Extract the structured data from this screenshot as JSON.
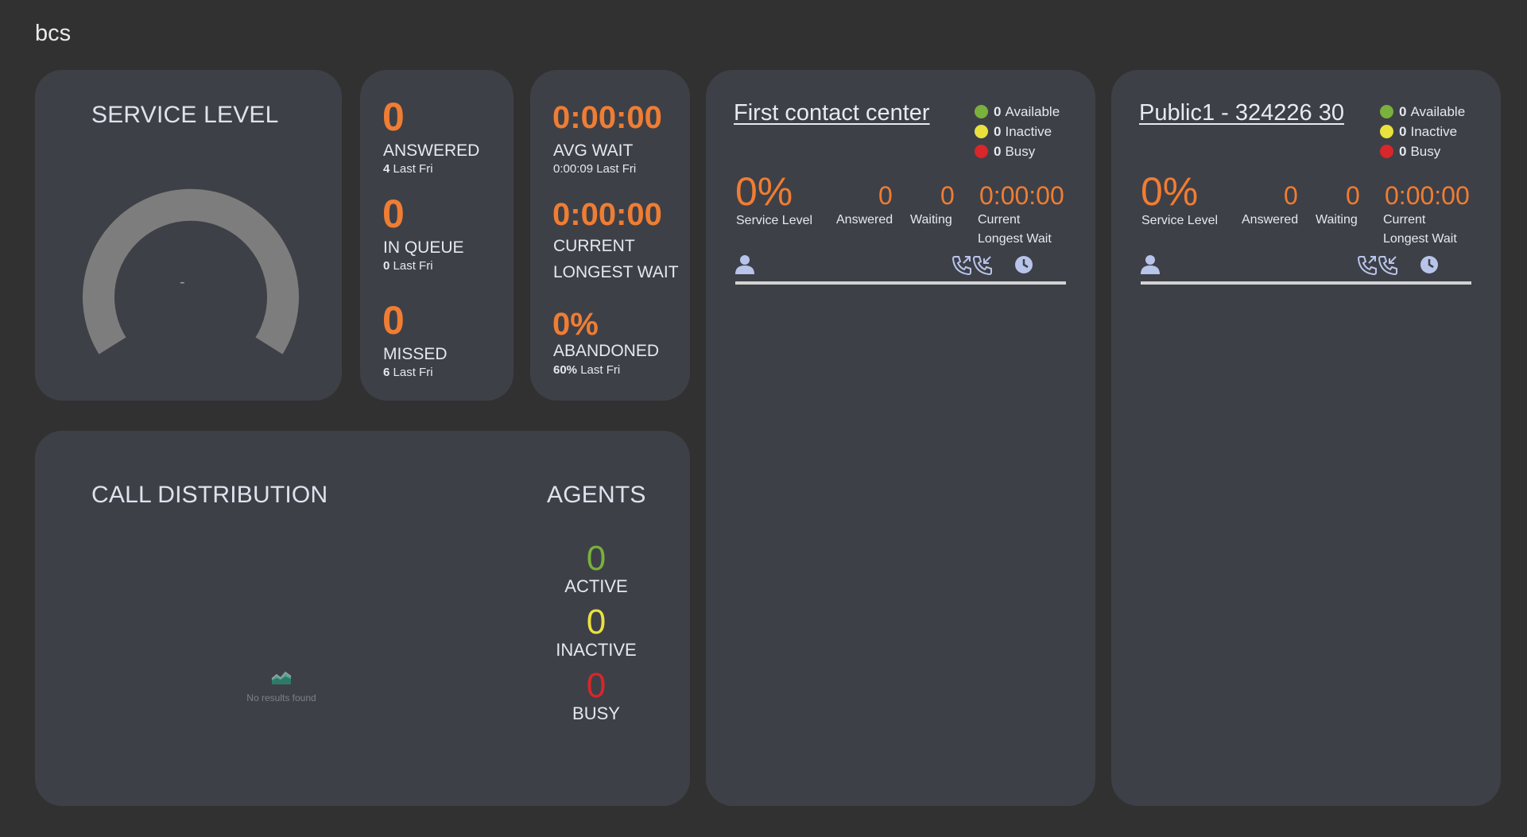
{
  "page": {
    "title": "bcs"
  },
  "service_level": {
    "title": "SERVICE LEVEL",
    "value": "-"
  },
  "stats_left": {
    "answered": {
      "value": "0",
      "label": "ANSWERED",
      "last_value": "4",
      "last_suffix": "Last Fri"
    },
    "in_queue": {
      "value": "0",
      "label": "IN QUEUE",
      "last_value": "0",
      "last_suffix": "Last Fri"
    },
    "missed": {
      "value": "0",
      "label": "MISSED",
      "last_value": "6",
      "last_suffix": "Last Fri"
    }
  },
  "stats_right": {
    "avg_wait": {
      "value": "0:00:00",
      "label": "AVG WAIT",
      "last_text": "0:00:09 Last Fri"
    },
    "longest_wait": {
      "value": "0:00:00",
      "label_line1": "CURRENT",
      "label_line2": "LONGEST WAIT"
    },
    "abandoned": {
      "value": "0%",
      "label": "ABANDONED",
      "last_value": "60%",
      "last_suffix": "Last Fri"
    }
  },
  "call_distribution": {
    "title": "CALL DISTRIBUTION",
    "empty_text": "No results found",
    "empty_icon": "area-chart-icon"
  },
  "agents": {
    "title": "AGENTS",
    "active": {
      "value": "0",
      "label": "ACTIVE",
      "color": "#7ab03c"
    },
    "inactive": {
      "value": "0",
      "label": "INACTIVE",
      "color": "#e9e23e"
    },
    "busy": {
      "value": "0",
      "label": "BUSY",
      "color": "#d9262a"
    }
  },
  "queues": [
    {
      "name": "First contact center",
      "legend": [
        {
          "count": "0",
          "label": "Available",
          "color": "#7ab03c"
        },
        {
          "count": "0",
          "label": "Inactive",
          "color": "#e9e23e"
        },
        {
          "count": "0",
          "label": "Busy",
          "color": "#d9262a"
        }
      ],
      "service_level": "0%",
      "service_level_label": "Service Level",
      "answered": "0",
      "answered_label": "Answered",
      "waiting": "0",
      "waiting_label": "Waiting",
      "longest_wait": "0:00:00",
      "longest_wait_label1": "Current",
      "longest_wait_label2": "Longest Wait",
      "icons": [
        "person-icon",
        "outgoing-call-icon",
        "incoming-call-icon",
        "clock-icon"
      ]
    },
    {
      "name": "Public1 - 324226 30",
      "legend": [
        {
          "count": "0",
          "label": "Available",
          "color": "#7ab03c"
        },
        {
          "count": "0",
          "label": "Inactive",
          "color": "#e9e23e"
        },
        {
          "count": "0",
          "label": "Busy",
          "color": "#d9262a"
        }
      ],
      "service_level": "0%",
      "service_level_label": "Service Level",
      "answered": "0",
      "answered_label": "Answered",
      "waiting": "0",
      "waiting_label": "Waiting",
      "longest_wait": "0:00:00",
      "longest_wait_label1": "Current",
      "longest_wait_label2": "Longest Wait",
      "icons": [
        "person-icon",
        "outgoing-call-icon",
        "incoming-call-icon",
        "clock-icon"
      ]
    }
  ],
  "colors": {
    "accent": "#ef7d33",
    "card_bg": "#3e4047",
    "page_bg": "#313131",
    "icon": "#b8c4ea"
  }
}
